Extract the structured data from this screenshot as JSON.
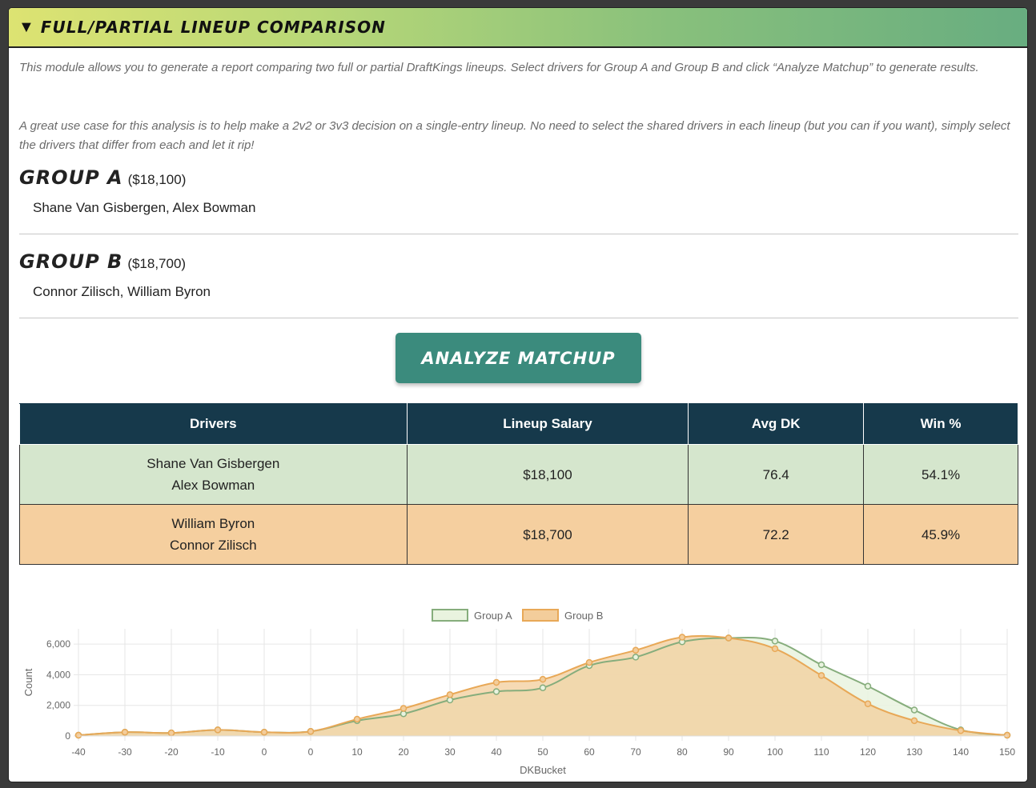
{
  "module": {
    "title": "Full/Partial Lineup Comparison",
    "description_1": "This module allows you to generate a report comparing two full or partial DraftKings lineups. Select drivers for Group A and Group B and click “Analyze Matchup” to generate results.",
    "description_2": "A great use case for this analysis is to help make a 2v2 or 3v3 decision on a single-entry lineup. No need to select the shared drivers in each lineup (but you can if you want), simply select the drivers that differ from each and let it rip!"
  },
  "group_a": {
    "title": "Group A",
    "salary": "($18,100)",
    "drivers": "Shane Van Gisbergen, Alex Bowman"
  },
  "group_b": {
    "title": "Group B",
    "salary": "($18,700)",
    "drivers": "Connor Zilisch, William Byron"
  },
  "analyze_button": "Analyze Matchup",
  "results_table": {
    "headers": [
      "Drivers",
      "Lineup Salary",
      "Avg DK",
      "Win %"
    ],
    "rows": [
      {
        "driver_1": "Shane Van Gisbergen",
        "driver_2": "Alex Bowman",
        "salary": "$18,100",
        "avg_dk": "76.4",
        "win_pct": "54.1%"
      },
      {
        "driver_1": "William Byron",
        "driver_2": "Connor Zilisch",
        "salary": "$18,700",
        "avg_dk": "72.2",
        "win_pct": "45.9%"
      }
    ]
  },
  "colors": {
    "group_a_line": "#86ad7c",
    "group_a_fill": "#e9f3df",
    "group_b_line": "#e8a857",
    "group_b_fill": "#f3cd9b",
    "header_bg": "#16394b",
    "button_bg": "#3b8b7d"
  },
  "chart_data": {
    "type": "area",
    "xlabel": "DKBucket",
    "ylabel": "Count",
    "x": [
      "-40",
      "-30",
      "-20",
      "-10",
      "0",
      "0",
      "10",
      "20",
      "30",
      "40",
      "50",
      "60",
      "70",
      "80",
      "90",
      "100",
      "110",
      "120",
      "130",
      "140",
      "150"
    ],
    "yticks": [
      "0",
      "2,000",
      "4,000",
      "6,000"
    ],
    "ylim": [
      0,
      7000
    ],
    "legend_position": "top-center",
    "grid": true,
    "series": [
      {
        "name": "Group A",
        "values": [
          50,
          250,
          200,
          400,
          250,
          300,
          1000,
          1450,
          2350,
          2900,
          3150,
          4600,
          5150,
          6150,
          6400,
          6200,
          4650,
          3250,
          1700,
          400,
          50
        ]
      },
      {
        "name": "Group B",
        "values": [
          50,
          250,
          200,
          400,
          250,
          300,
          1100,
          1800,
          2700,
          3500,
          3700,
          4800,
          5600,
          6450,
          6400,
          5700,
          3950,
          2100,
          1000,
          350,
          50
        ]
      }
    ]
  }
}
